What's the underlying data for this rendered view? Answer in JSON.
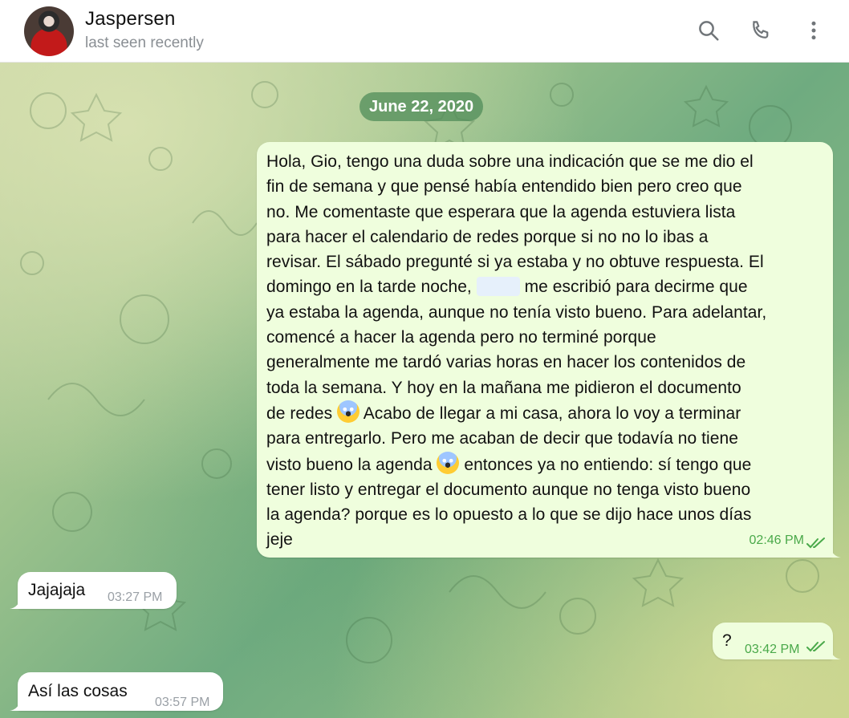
{
  "header": {
    "name": "Jaspersen",
    "status": "last seen recently",
    "icons": [
      "search-icon",
      "phone-icon",
      "more-vertical-icon"
    ]
  },
  "chat": {
    "date": "June 22, 2020",
    "messages": [
      {
        "direction": "out",
        "line1": "Hola, Gio, tengo una duda sobre una indicación que se me dio el",
        "line2": "fin de semana y que pensé había entendido bien pero creo que",
        "line3": "no. Me comentaste que esperara que la agenda estuviera lista",
        "line4": "para hacer el calendario de redes porque si no no lo ibas a",
        "line5": "revisar. El sábado pregunté si ya estaba y no obtuve respuesta. El",
        "line6a": "domingo en la tarde noche,",
        "line6b": "me escribió para decirme que",
        "line7": "ya estaba la agenda, aunque no tenía visto bueno. Para adelantar,",
        "line8": "comencé a hacer la agenda pero no terminé porque",
        "line9": "generalmente me tardó varias horas en hacer los contenidos de",
        "line10": "toda la semana. Y hoy en la mañana me pidieron el documento",
        "line11a": "de redes",
        "line11b": "Acabo de llegar a mi casa, ahora lo voy a terminar",
        "line12": "para entregarlo. Pero me acaban de decir que todavía no tiene",
        "line13a": "visto bueno la agenda",
        "line13b": "entonces ya no entiendo: sí tengo que",
        "line14": "tener listo y entregar el documento aunque no tenga visto bueno",
        "line15": "la agenda? porque es lo opuesto a lo que se dijo hace unos días",
        "line16": "jeje",
        "time": "02:46 PM",
        "emoji": "scream-emoji"
      },
      {
        "direction": "in",
        "text": "Jajajaja",
        "time": "03:27 PM"
      },
      {
        "direction": "out",
        "text": "?",
        "time": "03:42 PM"
      },
      {
        "direction": "in",
        "text": "Así las cosas",
        "time": "03:57 PM"
      }
    ]
  },
  "colors": {
    "outgoing_bubble": "#effedd",
    "incoming_bubble": "#ffffff",
    "time_outgoing": "#4aa94a",
    "date_pill": "#508c5a"
  }
}
